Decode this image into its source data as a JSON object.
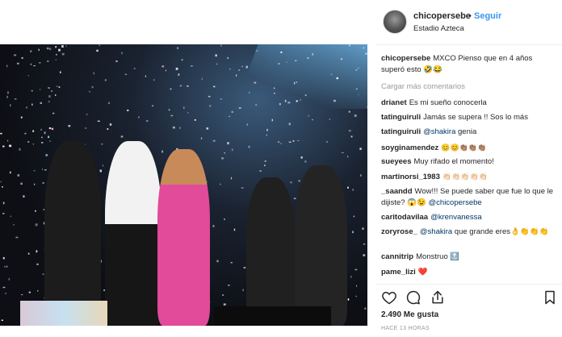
{
  "header": {
    "username": "chicopersebe",
    "dot": "•",
    "follow_label": "Seguir",
    "location": "Estadio Azteca"
  },
  "caption": {
    "username": "chicopersebe",
    "text": "MXCO Pienso que en 4 años superó esto 🤣😂"
  },
  "load_more_label": "Cargar más comentarios",
  "comments": [
    {
      "user": "drianet",
      "text": "Es mi sueño conocerla"
    },
    {
      "user": "tatinguiruli",
      "text": "Jamás se supera !! Sos lo más"
    },
    {
      "user": "tatinguiruli",
      "mention": "@shakira",
      "text": " genia"
    },
    {
      "user": "soyginamendez",
      "text": "😊😊👏🏽👏🏽👏🏽"
    },
    {
      "user": "sueyees",
      "text": "Muy rifado el momento!"
    },
    {
      "user": "martinorsi_1983",
      "text": "👏🏻👏🏻👏🏻👏🏻👏🏻"
    },
    {
      "user": "_saandd",
      "text": "Wow!!! Se puede saber que fue lo que le dijiste? 😱😉",
      "mention": "@chicopersebe"
    },
    {
      "user": "caritodavilaa",
      "mention": "@krenvanessa",
      "text": ""
    },
    {
      "user": "zoryrose_",
      "mention": "@shakira",
      "text": " que grande eres👌👏👏👏"
    },
    {
      "user": "cannitrip",
      "text": "Monstruo 🔝"
    },
    {
      "user": "pame_lizi",
      "text": "❤️"
    }
  ],
  "actions": {
    "icons": [
      "heart-icon",
      "comment-icon",
      "share-icon",
      "bookmark-icon"
    ],
    "likes": "2.490 Me gusta",
    "time": "HACE 13 HORAS"
  },
  "colors": {
    "link": "#3897f0",
    "mention": "#003569",
    "muted": "#999999",
    "like_heart": "#ed4956"
  }
}
